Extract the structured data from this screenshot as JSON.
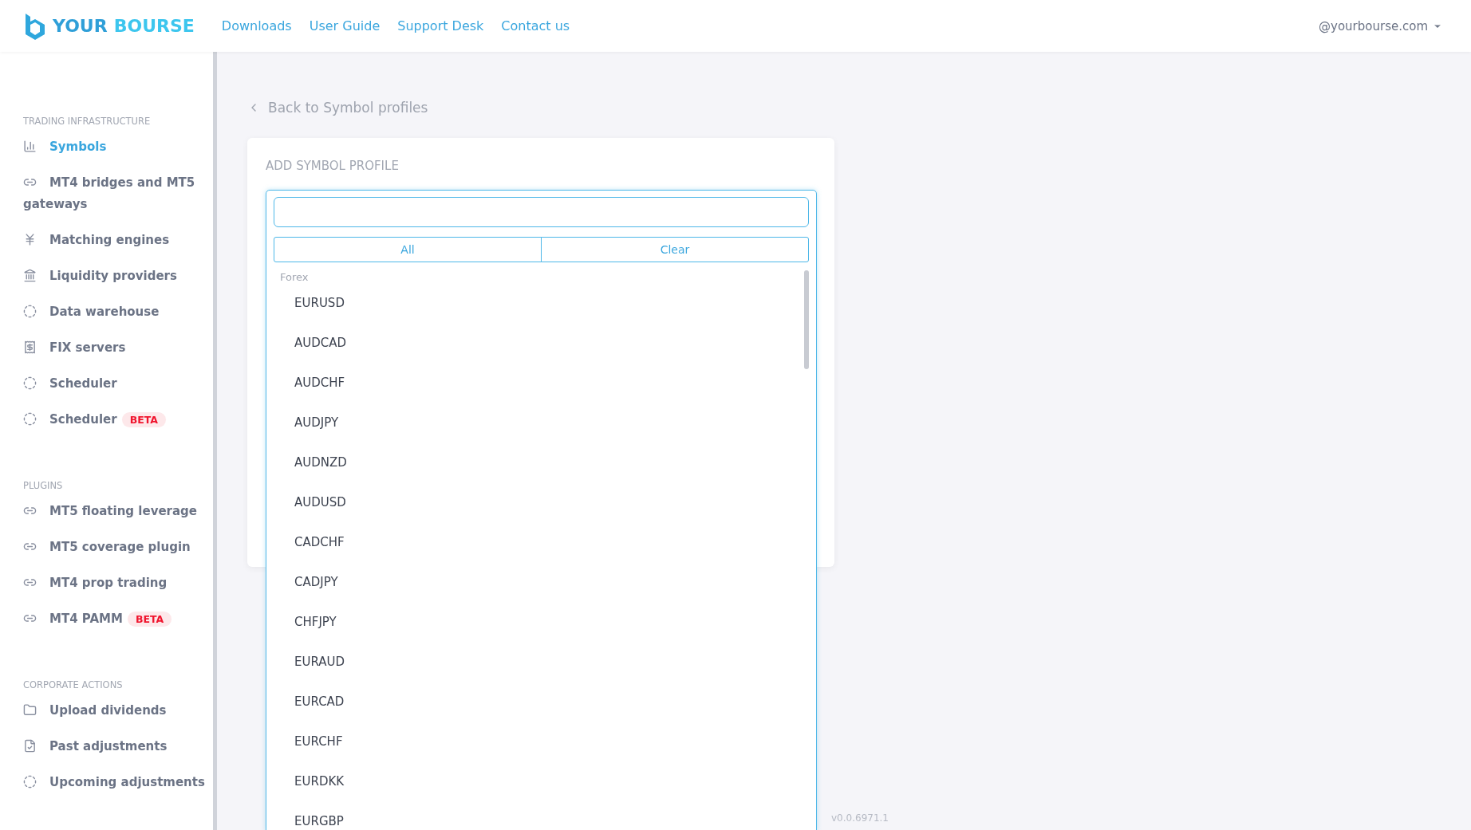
{
  "header": {
    "brand": {
      "first": "YOUR",
      "second": "BOURSE"
    },
    "nav": [
      "Downloads",
      "User Guide",
      "Support Desk",
      "Contact us"
    ],
    "account": "@yourbourse.com"
  },
  "sidebar": {
    "sections": [
      {
        "title": "TRADING INFRASTRUCTURE",
        "items": [
          {
            "label": "Symbols",
            "selected": true
          },
          {
            "label": "MT4 bridges and MT5 gateways",
            "selected": false
          },
          {
            "label": "Matching engines",
            "selected": false
          },
          {
            "label": "Liquidity providers",
            "selected": false
          },
          {
            "label": "Data warehouse",
            "selected": false
          },
          {
            "label": "FIX servers",
            "selected": false
          },
          {
            "label": "Scheduler",
            "selected": false
          },
          {
            "label": "Scheduler",
            "selected": false,
            "badge": "BETA"
          }
        ]
      },
      {
        "title": "PLUGINS",
        "items": [
          {
            "label": "MT5 floating leverage",
            "selected": false
          },
          {
            "label": "MT5 coverage plugin",
            "selected": false
          },
          {
            "label": "MT4 prop trading",
            "selected": false
          },
          {
            "label": "MT4 PAMM",
            "selected": false,
            "badge": "BETA"
          }
        ]
      },
      {
        "title": "CORPORATE ACTIONS",
        "items": [
          {
            "label": "Upload dividends",
            "selected": false
          },
          {
            "label": "Past adjustments",
            "selected": false
          },
          {
            "label": "Upcoming adjustments",
            "selected": false
          }
        ]
      }
    ]
  },
  "back_link": "Back to Symbol profiles",
  "card": {
    "title": "ADD SYMBOL PROFILE"
  },
  "dropdown": {
    "buttons": [
      "All",
      "Clear"
    ],
    "group": "Forex",
    "options": [
      "EURUSD",
      "AUDCAD",
      "AUDCHF",
      "AUDJPY",
      "AUDNZD",
      "AUDUSD",
      "CADCHF",
      "CADJPY",
      "CHFJPY",
      "EURAUD",
      "EURCAD",
      "EURCHF",
      "EURDKK",
      "EURGBP"
    ]
  },
  "version": "v0.0.6971.1"
}
